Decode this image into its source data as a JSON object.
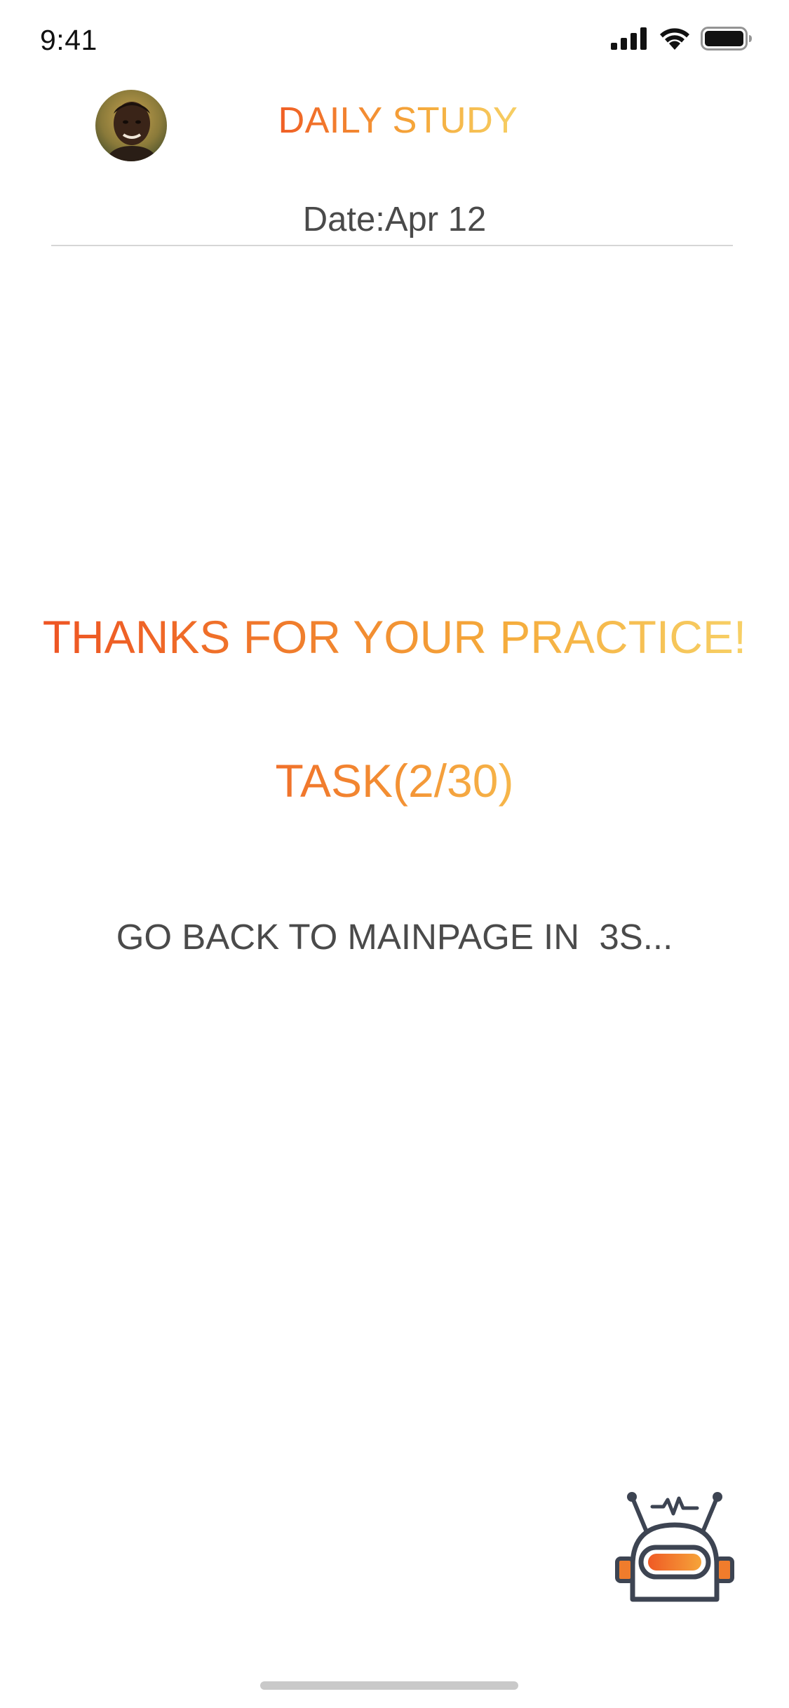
{
  "status_bar": {
    "time": "9:41",
    "icons": [
      "cellular-signal-icon",
      "wifi-icon",
      "battery-icon"
    ]
  },
  "header": {
    "title": "DAILY STUDY",
    "avatar": "avatar",
    "date": "Date:Apr 12"
  },
  "main": {
    "thanks_message": "THANKS FOR YOUR PRACTICE!",
    "task_progress": "TASK(2/30)",
    "countdown_message": "GO BACK TO MAINPAGE IN  3S..."
  },
  "assistant": {
    "icon": "robot-icon"
  },
  "colors": {
    "gradient_start": "#ef5a24",
    "gradient_end": "#f6cf63",
    "text_gray": "#4a4a4a",
    "robot_outline": "#3d4452",
    "robot_visor": "#f07c2c"
  }
}
